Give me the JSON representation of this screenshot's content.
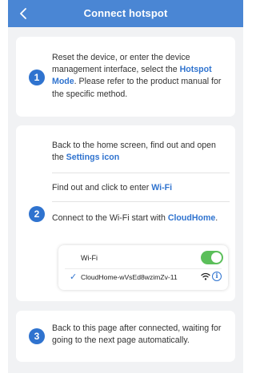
{
  "header": {
    "title": "Connect hotspot",
    "back_icon": "chevron-left-icon"
  },
  "step1": {
    "number": "1",
    "text_before": "Reset the device, or enter the device management interface, select the ",
    "highlight": "Hotspot Mode",
    "text_after": ". Please refer to the product manual for the specific method."
  },
  "step2": {
    "number": "2",
    "a_before": "Back to the home screen, find out and open the ",
    "a_highlight": "Settings icon",
    "b_before": "Find out and click to enter ",
    "b_highlight": "Wi-Fi",
    "c_before": "Connect to the Wi-Fi start with ",
    "c_highlight": "CloudHome",
    "c_after": ".",
    "wifi": {
      "label": "Wi-Fi",
      "enabled": true,
      "check": "✓",
      "ssid": "CloudHome-wVsEd8wzimZv-11",
      "info": "i"
    }
  },
  "step3": {
    "number": "3",
    "text": "Back to this page after connected, waiting for going to the next page automatically."
  },
  "colors": {
    "header": "#4a86d4",
    "accent": "#2f73cf",
    "toggle_on": "#5bbf5a",
    "background": "#f1f2f4"
  }
}
